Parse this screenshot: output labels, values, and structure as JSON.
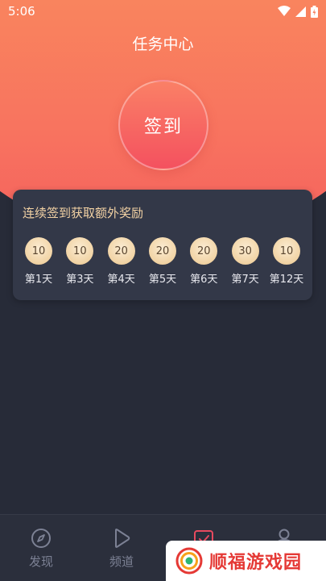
{
  "status_bar": {
    "time": "5:06"
  },
  "header": {
    "title": "任务中心"
  },
  "signin": {
    "label": "签到"
  },
  "reward_card": {
    "title": "连续签到获取额外奖励",
    "items": [
      {
        "value": "10",
        "day": "第1天"
      },
      {
        "value": "10",
        "day": "第3天"
      },
      {
        "value": "20",
        "day": "第4天"
      },
      {
        "value": "20",
        "day": "第5天"
      },
      {
        "value": "20",
        "day": "第6天"
      },
      {
        "value": "30",
        "day": "第7天"
      },
      {
        "value": "10",
        "day": "第12天"
      }
    ]
  },
  "bottom_nav": {
    "items": [
      {
        "label": "发现",
        "icon": "compass-icon"
      },
      {
        "label": "频道",
        "icon": "play-icon"
      },
      {
        "label": "",
        "icon": "task-check-icon"
      },
      {
        "label": "",
        "icon": "person-icon"
      }
    ]
  },
  "watermark": {
    "text": "顺福游戏园"
  },
  "colors": {
    "accent": "#f4605e",
    "gold_text": "#f3d2a4",
    "card_bg": "#333848",
    "page_bg": "#272b38",
    "nav_inactive": "#7c8194",
    "nav_active": "#e84a5f"
  }
}
